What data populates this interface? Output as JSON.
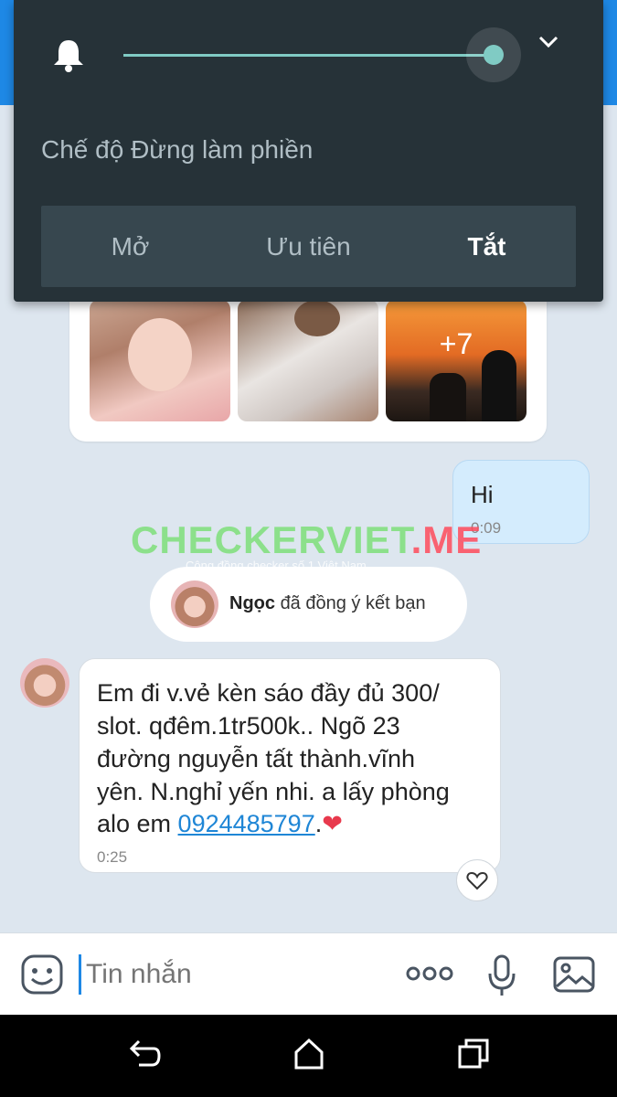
{
  "dnd_panel": {
    "title": "Chế độ Đừng làm phiền",
    "volume_level": 1.0,
    "options": [
      "Mở",
      "Ưu tiên",
      "Tắt"
    ],
    "selected": "Tắt",
    "icons": {
      "bell": "bell-icon",
      "expand": "chevron-down-icon"
    }
  },
  "chat": {
    "photo_grid": {
      "more_count": "+7"
    },
    "sent_message": {
      "text": "Hi",
      "time": "0:09"
    },
    "watermark": {
      "main": "CHECKERVIET",
      "suffix": ".ME",
      "sub": "Cộng đồng checker số 1 Việt Nam"
    },
    "system_notice": {
      "name": "Ngọc",
      "text": "đã đồng ý kết bạn"
    },
    "received_message": {
      "lines": [
        "Em đi v.vẻ kèn sáo đầy đủ 300/",
        "slot. qđêm.1tr500k.. Ngõ 23",
        "đường nguyễn tất thành.vĩnh",
        "yên. N.nghỉ yến nhi. a lấy phòng"
      ],
      "last_line_prefix": "alo em ",
      "phone": "0924485797",
      "last_line_suffix": ".",
      "emoji": "❤",
      "time": "0:25"
    }
  },
  "composer": {
    "placeholder": "Tin nhắn",
    "icons": [
      "emoji-icon",
      "more-icon",
      "microphone-icon",
      "image-icon"
    ]
  },
  "navbar": {
    "icons": [
      "back-icon",
      "home-icon",
      "recents-icon"
    ]
  },
  "colors": {
    "accent": "#1e88e5",
    "panel_bg": "#263238",
    "slider": "#80cbc4",
    "link": "#1f86d6"
  }
}
